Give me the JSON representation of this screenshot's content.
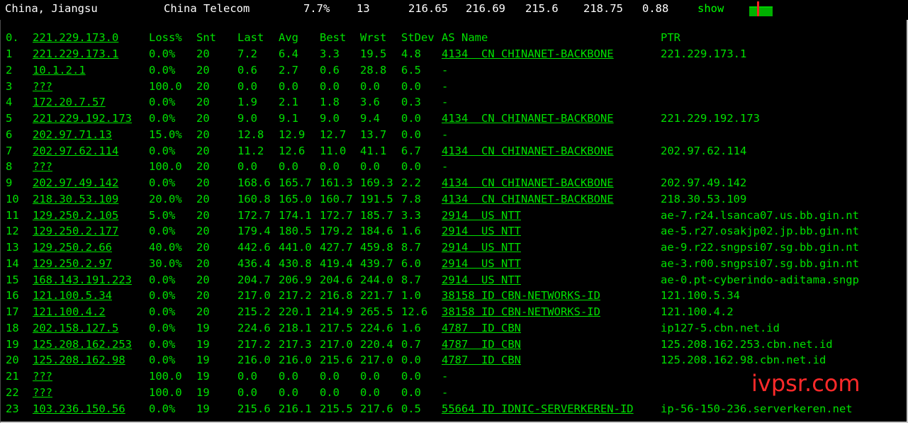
{
  "header": {
    "location": "China, Jiangsu",
    "isp": "China Telecom",
    "loss": "7.7%",
    "sent": "13",
    "last": "216.65",
    "avg": "216.69",
    "best": "215.6",
    "worst": "218.75",
    "stdev": "0.88",
    "show_label": "show",
    "sparkline_colors": {
      "bar": "#00b000",
      "spike": "#ff2020"
    }
  },
  "table": {
    "columns": {
      "idx": "0.",
      "host": "221.229.173.0",
      "loss": "Loss%",
      "snt": "Snt",
      "last": "Last",
      "avg": "Avg",
      "best": "Best",
      "wrst": "Wrst",
      "stdev": "StDev",
      "as": "AS Name",
      "ptr": "PTR"
    },
    "rows": [
      {
        "idx": "1",
        "host": "221.229.173.1",
        "loss": "0.0%",
        "snt": "20",
        "last": "7.2",
        "avg": "6.4",
        "best": "3.3",
        "wrst": "19.5",
        "stdev": "4.8",
        "as": "4134  CN CHINANET-BACKBONE",
        "ptr": "221.229.173.1"
      },
      {
        "idx": "2",
        "host": "10.1.2.1",
        "loss": "0.0%",
        "snt": "20",
        "last": "0.6",
        "avg": "2.7",
        "best": "0.6",
        "wrst": "28.8",
        "stdev": "6.5",
        "as": "-",
        "ptr": ""
      },
      {
        "idx": "3",
        "host": "???",
        "loss": "100.0",
        "snt": "20",
        "last": "0.0",
        "avg": "0.0",
        "best": "0.0",
        "wrst": "0.0",
        "stdev": "0.0",
        "as": "-",
        "ptr": ""
      },
      {
        "idx": "4",
        "host": "172.20.7.57",
        "loss": "0.0%",
        "snt": "20",
        "last": "1.9",
        "avg": "2.1",
        "best": "1.8",
        "wrst": "3.6",
        "stdev": "0.3",
        "as": "-",
        "ptr": ""
      },
      {
        "idx": "5",
        "host": "221.229.192.173",
        "loss": "0.0%",
        "snt": "20",
        "last": "9.0",
        "avg": "9.1",
        "best": "9.0",
        "wrst": "9.4",
        "stdev": "0.0",
        "as": "4134  CN CHINANET-BACKBONE",
        "ptr": "221.229.192.173"
      },
      {
        "idx": "6",
        "host": "202.97.71.13",
        "loss": "15.0%",
        "snt": "20",
        "last": "12.8",
        "avg": "12.9",
        "best": "12.7",
        "wrst": "13.7",
        "stdev": "0.0",
        "as": "-",
        "ptr": ""
      },
      {
        "idx": "7",
        "host": "202.97.62.114",
        "loss": "0.0%",
        "snt": "20",
        "last": "11.2",
        "avg": "12.6",
        "best": "11.0",
        "wrst": "41.1",
        "stdev": "6.7",
        "as": "4134  CN CHINANET-BACKBONE",
        "ptr": "202.97.62.114"
      },
      {
        "idx": "8",
        "host": "???",
        "loss": "100.0",
        "snt": "20",
        "last": "0.0",
        "avg": "0.0",
        "best": "0.0",
        "wrst": "0.0",
        "stdev": "0.0",
        "as": "-",
        "ptr": ""
      },
      {
        "idx": "9",
        "host": "202.97.49.142",
        "loss": "0.0%",
        "snt": "20",
        "last": "168.6",
        "avg": "165.7",
        "best": "161.3",
        "wrst": "169.3",
        "stdev": "2.2",
        "as": "4134  CN CHINANET-BACKBONE",
        "ptr": "202.97.49.142"
      },
      {
        "idx": "10",
        "host": "218.30.53.109",
        "loss": "20.0%",
        "snt": "20",
        "last": "160.8",
        "avg": "165.0",
        "best": "160.7",
        "wrst": "191.5",
        "stdev": "7.8",
        "as": "4134  CN CHINANET-BACKBONE",
        "ptr": "218.30.53.109"
      },
      {
        "idx": "11",
        "host": "129.250.2.105",
        "loss": "5.0%",
        "snt": "20",
        "last": "172.7",
        "avg": "174.1",
        "best": "172.7",
        "wrst": "185.7",
        "stdev": "3.3",
        "as": "2914  US NTT",
        "ptr": "ae-7.r24.lsanca07.us.bb.gin.nt"
      },
      {
        "idx": "12",
        "host": "129.250.2.177",
        "loss": "0.0%",
        "snt": "20",
        "last": "179.4",
        "avg": "180.5",
        "best": "179.2",
        "wrst": "184.6",
        "stdev": "1.6",
        "as": "2914  US NTT",
        "ptr": "ae-5.r27.osakjp02.jp.bb.gin.nt"
      },
      {
        "idx": "13",
        "host": "129.250.2.66",
        "loss": "40.0%",
        "snt": "20",
        "last": "442.6",
        "avg": "441.0",
        "best": "427.7",
        "wrst": "459.8",
        "stdev": "8.7",
        "as": "2914  US NTT",
        "ptr": "ae-9.r22.sngpsi07.sg.bb.gin.nt"
      },
      {
        "idx": "14",
        "host": "129.250.2.97",
        "loss": "30.0%",
        "snt": "20",
        "last": "436.4",
        "avg": "430.8",
        "best": "419.4",
        "wrst": "439.7",
        "stdev": "6.0",
        "as": "2914  US NTT",
        "ptr": "ae-3.r00.sngpsi07.sg.bb.gin.nt"
      },
      {
        "idx": "15",
        "host": "168.143.191.223",
        "loss": "0.0%",
        "snt": "20",
        "last": "204.7",
        "avg": "206.9",
        "best": "204.6",
        "wrst": "244.0",
        "stdev": "8.7",
        "as": "2914  US NTT",
        "ptr": "ae-0.pt-cyberindo-aditama.sngp"
      },
      {
        "idx": "16",
        "host": "121.100.5.34",
        "loss": "0.0%",
        "snt": "20",
        "last": "217.0",
        "avg": "217.2",
        "best": "216.8",
        "wrst": "221.7",
        "stdev": "1.0",
        "as": "38158 ID CBN-NETWORKS-ID",
        "ptr": "121.100.5.34"
      },
      {
        "idx": "17",
        "host": "121.100.4.2",
        "loss": "0.0%",
        "snt": "20",
        "last": "215.2",
        "avg": "220.1",
        "best": "214.9",
        "wrst": "265.5",
        "stdev": "12.6",
        "as": "38158 ID CBN-NETWORKS-ID",
        "ptr": "121.100.4.2"
      },
      {
        "idx": "18",
        "host": "202.158.127.5",
        "loss": "0.0%",
        "snt": "19",
        "last": "224.6",
        "avg": "218.1",
        "best": "217.5",
        "wrst": "224.6",
        "stdev": "1.6",
        "as": "4787  ID CBN",
        "ptr": "ip127-5.cbn.net.id"
      },
      {
        "idx": "19",
        "host": "125.208.162.253",
        "loss": "0.0%",
        "snt": "19",
        "last": "217.2",
        "avg": "217.3",
        "best": "217.0",
        "wrst": "220.4",
        "stdev": "0.7",
        "as": "4787  ID CBN",
        "ptr": "125.208.162.253.cbn.net.id"
      },
      {
        "idx": "20",
        "host": "125.208.162.98",
        "loss": "0.0%",
        "snt": "19",
        "last": "216.0",
        "avg": "216.0",
        "best": "215.6",
        "wrst": "217.0",
        "stdev": "0.0",
        "as": "4787  ID CBN",
        "ptr": "125.208.162.98.cbn.net.id"
      },
      {
        "idx": "21",
        "host": "???",
        "loss": "100.0",
        "snt": "19",
        "last": "0.0",
        "avg": "0.0",
        "best": "0.0",
        "wrst": "0.0",
        "stdev": "0.0",
        "as": "-",
        "ptr": ""
      },
      {
        "idx": "22",
        "host": "???",
        "loss": "100.0",
        "snt": "19",
        "last": "0.0",
        "avg": "0.0",
        "best": "0.0",
        "wrst": "0.0",
        "stdev": "0.0",
        "as": "-",
        "ptr": ""
      },
      {
        "idx": "23",
        "host": "103.236.150.56",
        "loss": "0.0%",
        "snt": "19",
        "last": "215.6",
        "avg": "216.1",
        "best": "215.5",
        "wrst": "217.6",
        "stdev": "0.5",
        "as": "55664 ID IDNIC-SERVERKEREN-ID",
        "ptr": "ip-56-150-236.serverkeren.net"
      }
    ]
  },
  "watermark": "ivpsr.com"
}
